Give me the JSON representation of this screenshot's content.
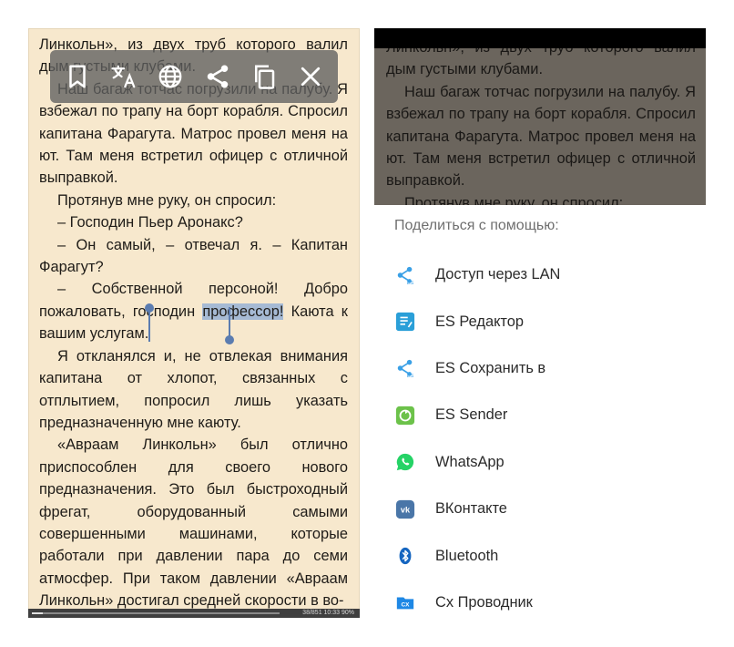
{
  "reader": {
    "para1": "Линкольн», из двух труб которого валил дым густыми клубами.",
    "para2": "Наш багаж тотчас погрузили на палубу. Я взбежал по трапу на борт корабля. Спросил капитана Фарагута. Матрос провел меня на ют. Там меня встретил офицер с отличной выправкой.",
    "para3": "Протянув мне руку, он спросил:",
    "para4": "– Господин Пьер Аронакс?",
    "para5": "– Он самый, – отвечал я. – Капитан Фарагут?",
    "para6_before": "– Собственной персоной! Добро пожаловать, господин ",
    "para6_selected": "профессор!",
    "para6_after": " Каюта к вашим услугам.",
    "para7": "Я откланялся и, не отвлекая внимания капитана от хлопот, связанных с отплытием, попросил лишь указать предназначенную мне каюту.",
    "para8": "«Авраам Линкольн» был отлично приспособлен для своего нового предназначения. Это был быстроходный фрегат, оборудованный самыми совершенными машинами, которые работали при давлении пара до семи атмосфер. При таком давлении «Авраам Линкольн» достигал средней скорости в во-"
  },
  "toolbar": {
    "icons": [
      "bookmark-icon",
      "translate-icon",
      "globe-icon",
      "share-icon",
      "copy-icon",
      "close-icon"
    ]
  },
  "status_bar": {
    "text": "38/851  10:33  90%",
    "progress": 0.045
  },
  "dimmed_reader": {
    "para1": "Линкольн», из двух труб которого валил дым густыми клубами.",
    "para2": "Наш багаж тотчас погрузили на палубу. Я взбежал по трапу на борт корабля. Спросил капитана Фарагута. Матрос провел меня на ют. Там меня встретил офицер с отличной выправкой.",
    "para3": "Протянув мне руку, он спросил:"
  },
  "share_sheet": {
    "title": "Поделиться с помощью:",
    "items": [
      {
        "label": "Доступ через LAN",
        "icon": "lan-share-icon",
        "color": "#3aa0e6"
      },
      {
        "label": "ES Редактор",
        "icon": "es-editor-icon",
        "color": "#2a9fd8"
      },
      {
        "label": "ES Сохранить в",
        "icon": "es-save-icon",
        "color": "#3aa0e6"
      },
      {
        "label": "ES Sender",
        "icon": "es-sender-icon",
        "color": "#6cc24a"
      },
      {
        "label": "WhatsApp",
        "icon": "whatsapp-icon",
        "color": "#25d366"
      },
      {
        "label": "ВКонтакте",
        "icon": "vk-icon",
        "color": "#4a76a8"
      },
      {
        "label": "Bluetooth",
        "icon": "bluetooth-icon",
        "color": "#1565c0"
      },
      {
        "label": "Cx Проводник",
        "icon": "cx-explorer-icon",
        "color": "#1e88e5"
      }
    ]
  }
}
